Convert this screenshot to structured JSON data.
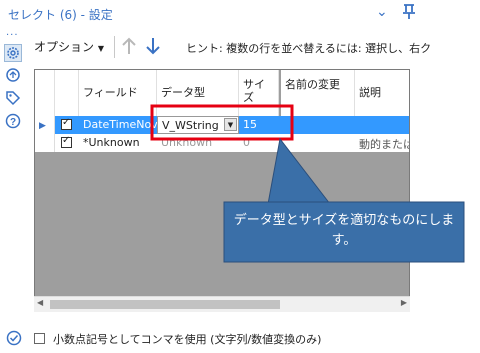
{
  "window": {
    "title": "セレクト (6) - 設定"
  },
  "toolbar": {
    "options_label": "オプション",
    "hint": "ヒント: 複数の行を並べ替えるには: 選択し、右ク"
  },
  "grid": {
    "columns": [
      "",
      "",
      "フィールド",
      "データ型",
      "サイズ",
      "名前の変更",
      "説明"
    ],
    "rows": [
      {
        "selected": true,
        "checked": true,
        "field": "DateTimeNov",
        "type": "V_WString",
        "size": "15",
        "rename": "",
        "description": ""
      },
      {
        "selected": false,
        "checked": true,
        "field": "*Unknown",
        "type": "Unknown",
        "size": "0",
        "rename": "",
        "description": "動的または"
      }
    ]
  },
  "callout": {
    "text": "データ型とサイズを適切なものにします。"
  },
  "footer": {
    "checkbox_label": "小数点記号としてコンマを使用 (文字列/数値変換のみ)"
  },
  "colors": {
    "accent": "#3a72c4",
    "selected_row": "#3399ff",
    "highlight_border": "#e60012",
    "callout": "#3a6fa8"
  },
  "icons": [
    "collapse-icon",
    "pin-icon",
    "gear-icon",
    "refresh-icon",
    "tag-icon",
    "help-icon",
    "up-arrow-icon",
    "down-arrow-icon",
    "row-pointer-icon",
    "check-circle-icon"
  ]
}
